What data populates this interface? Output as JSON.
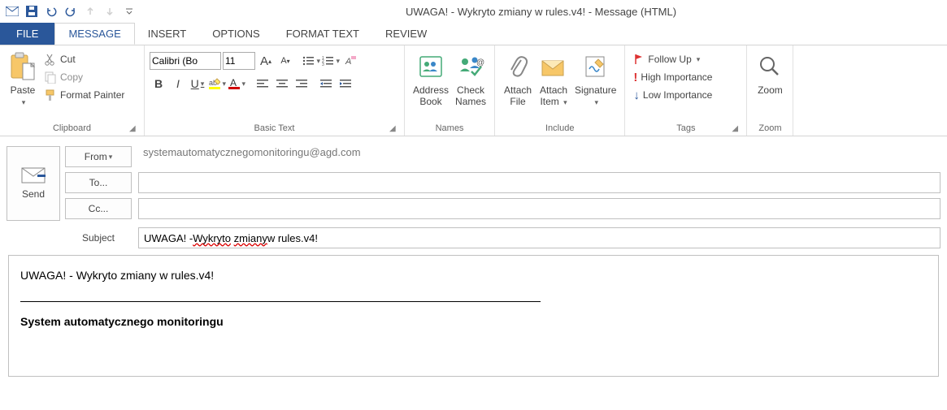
{
  "window": {
    "title": "UWAGA! - Wykryto zmiany w rules.v4! - Message (HTML)"
  },
  "tabs": {
    "file": "FILE",
    "message": "MESSAGE",
    "insert": "INSERT",
    "options": "OPTIONS",
    "format_text": "FORMAT TEXT",
    "review": "REVIEW"
  },
  "ribbon": {
    "clipboard": {
      "label": "Clipboard",
      "paste": "Paste",
      "cut": "Cut",
      "copy": "Copy",
      "format_painter": "Format Painter"
    },
    "basic_text": {
      "label": "Basic Text",
      "font_name": "Calibri (Bo",
      "font_size": "11"
    },
    "names": {
      "label": "Names",
      "address_book": "Address\nBook",
      "check_names": "Check\nNames"
    },
    "include": {
      "label": "Include",
      "attach_file": "Attach\nFile",
      "attach_item": "Attach\nItem",
      "signature": "Signature"
    },
    "tags": {
      "label": "Tags",
      "follow_up": "Follow Up",
      "high_importance": "High Importance",
      "low_importance": "Low Importance"
    },
    "zoom": {
      "label": "Zoom",
      "zoom": "Zoom"
    }
  },
  "compose": {
    "send": "Send",
    "from_label": "From",
    "from_value": "systemautomatycznegomonitoringu@agd.com",
    "to_label": "To...",
    "to_value": "",
    "cc_label": "Cc...",
    "cc_value": "",
    "subject_label": "Subject",
    "subject_value": "UWAGA! - Wykryto zmiany w rules.v4!",
    "subject_plain_prefix": "UWAGA! - ",
    "subject_wavy1": "Wykryto",
    "subject_mid": " ",
    "subject_wavy2": "zmiany",
    "subject_suffix": " w rules.v4!"
  },
  "body": {
    "line1": "UWAGA! - Wykryto zmiany w rules.v4!",
    "signature": "System automatycznego monitoringu"
  }
}
